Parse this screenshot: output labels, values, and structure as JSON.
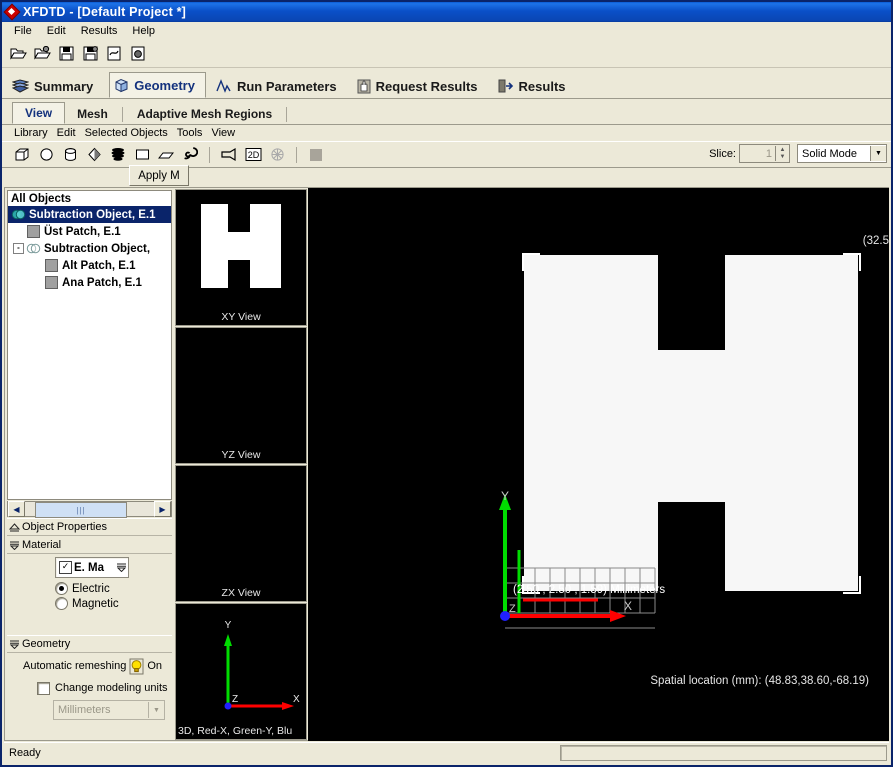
{
  "window": {
    "title": "XFDTD - [Default Project *]",
    "icon": "xfdtd-diamond-icon"
  },
  "menubar": {
    "items": [
      {
        "label": "File"
      },
      {
        "label": "Edit"
      },
      {
        "label": "Results"
      },
      {
        "label": "Help"
      }
    ]
  },
  "toolbar": {
    "buttons": [
      {
        "name": "open-project-icon"
      },
      {
        "name": "open-project-options-icon"
      },
      {
        "name": "save-project-icon"
      },
      {
        "name": "save-project-as-icon"
      },
      {
        "name": "signal-document-icon"
      },
      {
        "name": "document-options-icon"
      }
    ]
  },
  "main_tabs": [
    {
      "label": "Summary",
      "icon": "books-icon",
      "selected": false
    },
    {
      "label": "Geometry",
      "icon": "cube-icon",
      "selected": true
    },
    {
      "label": "Run Parameters",
      "icon": "waveform-icon",
      "selected": false
    },
    {
      "label": "Request Results",
      "icon": "hand-icon",
      "selected": false
    },
    {
      "label": "Results",
      "icon": "export-icon",
      "selected": false
    }
  ],
  "sub_tabs": [
    {
      "label": "View",
      "selected": true
    },
    {
      "label": "Mesh",
      "selected": false
    },
    {
      "label": "Adaptive Mesh Regions",
      "selected": false
    }
  ],
  "geometry_menu": {
    "items": [
      {
        "label": "Library"
      },
      {
        "label": "Edit"
      },
      {
        "label": "Selected Objects"
      },
      {
        "label": "Tools"
      },
      {
        "label": "View"
      }
    ]
  },
  "geometry_toolbar": {
    "buttons": [
      {
        "name": "box-icon"
      },
      {
        "name": "sphere-icon"
      },
      {
        "name": "cylinder-icon"
      },
      {
        "name": "cone-icon"
      },
      {
        "name": "stack-icon"
      },
      {
        "name": "rectangle-icon"
      },
      {
        "name": "parallelogram-icon"
      },
      {
        "name": "spiral-icon"
      },
      {
        "name": "horn-icon"
      },
      {
        "name": "2d-icon"
      },
      {
        "name": "wireframe-sphere-icon"
      },
      {
        "name": "color-swatch-icon"
      }
    ],
    "slice_label": "Slice:",
    "slice_value": "1",
    "display_mode": "Solid Mode"
  },
  "object_tree": {
    "header": "All Objects",
    "nodes": [
      {
        "label": "Subtraction Object, E.1",
        "icon": "subtraction-object-icon",
        "level": 0,
        "selected": true
      },
      {
        "label": "Üst Patch, E.1",
        "icon": "patch-icon",
        "level": 1,
        "selected": false
      },
      {
        "label": "Subtraction Object,",
        "icon": "subtraction-object-outline-icon",
        "level": 1,
        "selected": false,
        "expander": "-"
      },
      {
        "label": "Alt Patch, E.1",
        "icon": "patch-icon",
        "level": 2,
        "selected": false
      },
      {
        "label": "Ana Patch, E.1",
        "icon": "patch-icon",
        "level": 2,
        "selected": false
      }
    ]
  },
  "properties": {
    "object_properties_label": "Object Properties",
    "material_label": "Material",
    "material_value": "E. Ma",
    "material_checked": true,
    "electric_label": "Electric",
    "magnetic_label": "Magnetic",
    "selected_polarity": "Electric",
    "apply_button": "Apply M",
    "geometry_label": "Geometry",
    "remesh_label": "Automatic remeshing",
    "remesh_state": "On",
    "change_units_label": "Change modeling units",
    "change_units_checked": false,
    "units_value": "Millimeters"
  },
  "previews": [
    {
      "label": "XY View",
      "shape": "h-patch"
    },
    {
      "label": "YZ View",
      "shape": "none"
    },
    {
      "label": "ZX View",
      "shape": "none"
    },
    {
      "label": "3D, Red-X, Green-Y, Blu",
      "shape": "axes"
    }
  ],
  "viewport": {
    "top_right_text": "(32.5",
    "coord_label": "(2.50 , 2.50 , 1.59) Millimeters",
    "spatial_location": "Spatial location (mm): (48.83,38.60,-68.19)",
    "axis_x_label": "X",
    "axis_y_label": "Y",
    "axis_z_label": "Z",
    "colors": {
      "background": "#000000",
      "patch": "#f7f7f7",
      "axis_x": "#ff0000",
      "axis_y": "#00dd00",
      "axis_z": "#2020ff",
      "grid": "#8a8a8a",
      "selection_bracket": "#ffffff"
    }
  },
  "statusbar": {
    "text": "Ready"
  }
}
